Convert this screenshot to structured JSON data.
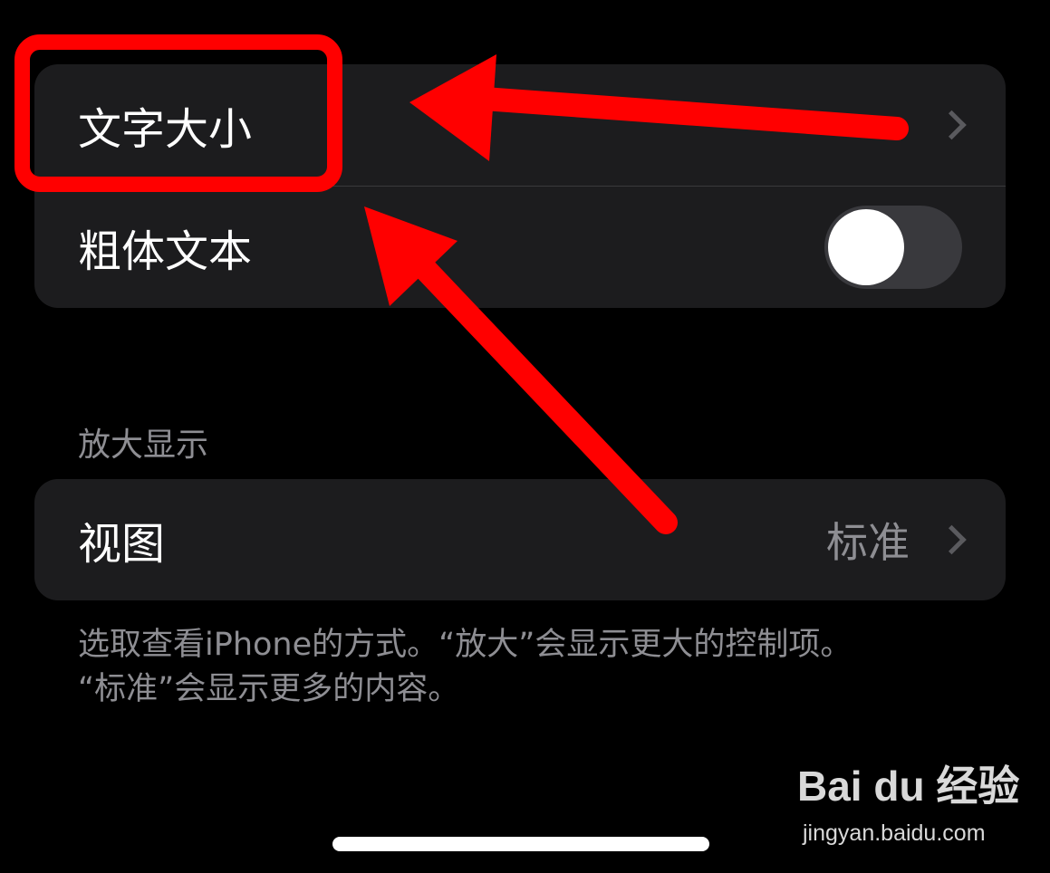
{
  "settings_group": {
    "text_size": {
      "label": "文字大小"
    },
    "bold_text": {
      "label": "粗体文本",
      "enabled": false
    }
  },
  "zoom_section": {
    "header": "放大显示",
    "view": {
      "label": "视图",
      "value": "标准"
    },
    "footer_line1": "选取查看iPhone的方式。“放大”会显示更大的控制项。",
    "footer_line2": "“标准”会显示更多的内容。"
  },
  "annotation": {
    "color": "#ff0000"
  },
  "watermark": {
    "logo": "Bai du 经验",
    "url": "jingyan.baidu.com"
  },
  "colors": {
    "background": "#000000",
    "cell": "#1c1c1e",
    "secondary_text": "#8e8e93",
    "toggle_off": "#39393d"
  }
}
